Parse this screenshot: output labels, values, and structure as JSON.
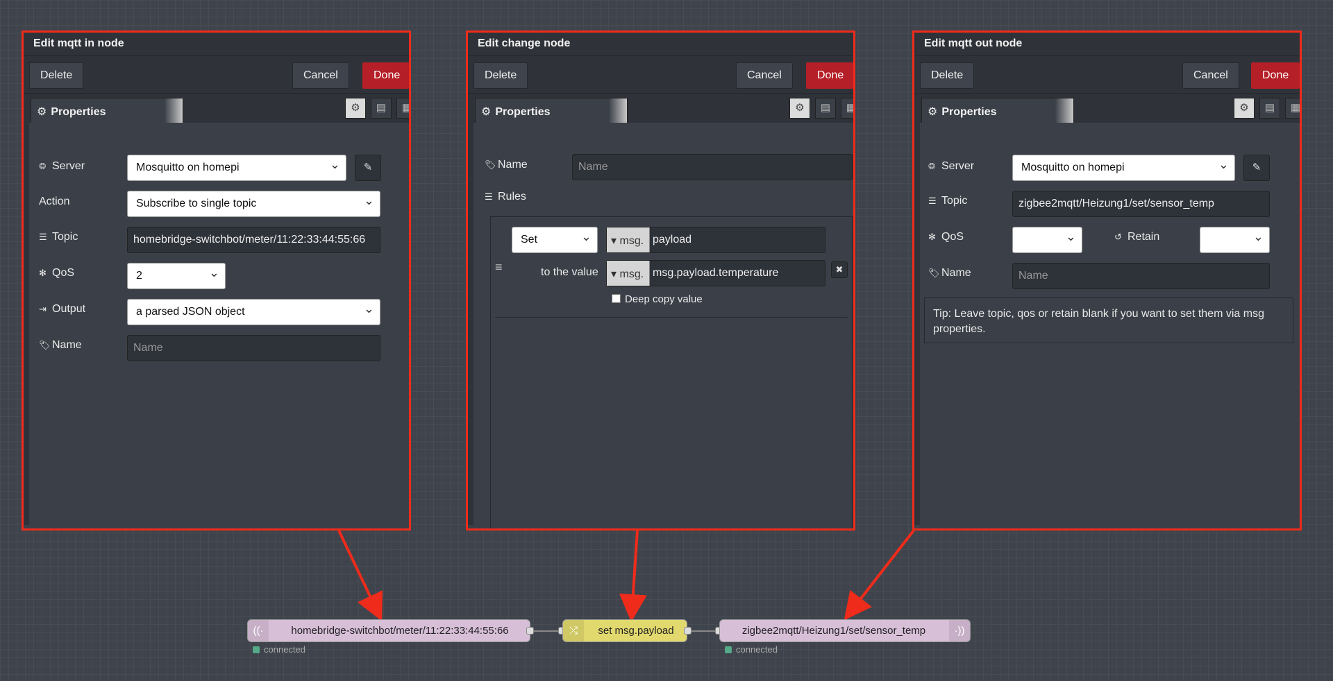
{
  "mqtt_in": {
    "title": "Edit mqtt in node",
    "delete_label": "Delete",
    "cancel_label": "Cancel",
    "done_label": "Done",
    "tab_label": "Properties",
    "server_label": "Server",
    "server_value": "Mosquitto on homepi",
    "action_label": "Action",
    "action_value": "Subscribe to single topic",
    "topic_label": "Topic",
    "topic_value": "homebridge-switchbot/meter/11:22:33:44:55:66",
    "qos_label": "QoS",
    "qos_value": "2",
    "output_label": "Output",
    "output_value": "a parsed JSON object",
    "name_label": "Name",
    "name_placeholder": "Name"
  },
  "change": {
    "title": "Edit change node",
    "delete_label": "Delete",
    "cancel_label": "Cancel",
    "done_label": "Done",
    "tab_label": "Properties",
    "name_label": "Name",
    "name_placeholder": "Name",
    "rules_label": "Rules",
    "rule_action": "Set",
    "rule_prefix": "msg.",
    "rule_property": "payload",
    "to_value_label": "to the value",
    "value_prefix": "msg.",
    "value_value": "msg.payload.temperature",
    "deep_copy_label": "Deep copy value"
  },
  "mqtt_out": {
    "title": "Edit mqtt out node",
    "delete_label": "Delete",
    "cancel_label": "Cancel",
    "done_label": "Done",
    "tab_label": "Properties",
    "server_label": "Server",
    "server_value": "Mosquitto on homepi",
    "topic_label": "Topic",
    "topic_value": "zigbee2mqtt/Heizung1/set/sensor_temp",
    "qos_label": "QoS",
    "retain_label": "Retain",
    "name_label": "Name",
    "name_placeholder": "Name",
    "tip": "Tip: Leave topic, qos or retain blank if you want to set them via msg properties."
  },
  "flow": {
    "in_node_label": "homebridge-switchbot/meter/11:22:33:44:55:66",
    "in_status": "connected",
    "change_node_label": "set msg.payload",
    "out_node_label": "zigbee2mqtt/Heizung1/set/sensor_temp",
    "out_status": "connected"
  },
  "colors": {
    "highlight_border": "#ef2b1b",
    "done_button": "#b51f27",
    "mqtt_node": "#d8bfd8",
    "change_node": "#e2d96e",
    "status_connected": "#55aa88"
  },
  "icons": {
    "settings": "gear-icon",
    "description": "document-icon",
    "appearance": "layout-icon",
    "server": "globe-icon",
    "topic": "list-icon",
    "qos": "asterisk-icon",
    "output": "sign-out-icon",
    "name": "tag-icon",
    "rules": "list-icon",
    "retain": "history-icon",
    "edit": "pencil-icon",
    "drag": "bars-icon",
    "remove": "close-icon",
    "mqtt": "antenna-icon",
    "change": "shuffle-icon"
  }
}
